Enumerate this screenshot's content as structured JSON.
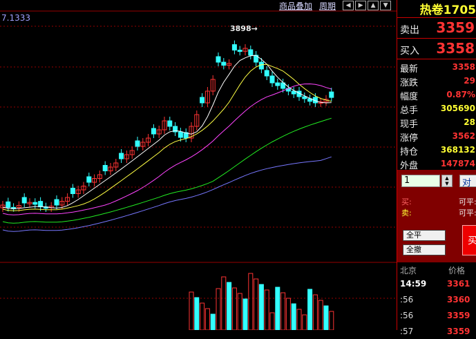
{
  "toolbar": {
    "overlay": "商品叠加",
    "period": "周期",
    "nav_icons": [
      "arrow-left-icon",
      "arrow-right-icon",
      "zoom-in-icon",
      "zoom-out-icon"
    ]
  },
  "chart": {
    "ma_value": "7.1333",
    "peak_label": "3898",
    "colors": {
      "up": "#ff3333",
      "down": "#33ffff",
      "grid": "#990000",
      "ma5": "#ffffff",
      "ma10": "#ffff44",
      "ma20": "#ff44ff",
      "ma40": "#22ee22",
      "ma60": "#7777ff"
    }
  },
  "quote": {
    "contract": "热卷1705",
    "sell": {
      "label": "卖出",
      "value": "3359"
    },
    "buy": {
      "label": "买入",
      "value": "3358"
    },
    "stats": [
      {
        "label": "最新",
        "value": "3358",
        "color": "#ff3333"
      },
      {
        "label": "涨跌",
        "value": "29",
        "color": "#ff3333"
      },
      {
        "label": "幅度",
        "value": "0.87%",
        "color": "#ff3333"
      },
      {
        "label": "总手",
        "value": "305690",
        "color": "#ffff33"
      },
      {
        "label": "现手",
        "value": "28",
        "color": "#ffff33"
      },
      {
        "label": "涨停",
        "value": "3562",
        "color": "#ff3333"
      },
      {
        "label": "持仓",
        "value": "368132",
        "color": "#ffff33"
      },
      {
        "label": "外盘",
        "value": "147874",
        "color": "#ff3333"
      }
    ]
  },
  "order": {
    "qty": "1",
    "side_button": "对手",
    "buy_label": "买:",
    "sell_label": "卖:",
    "avail_buy": "可平:",
    "avail_sell": "可平:",
    "close_all": "全平",
    "cancel_all": "全撤",
    "submit": "买"
  },
  "ticks": {
    "header_loc": "北京",
    "header_price": "价格",
    "rows": [
      {
        "time": "14:59",
        "price": "3361"
      },
      {
        "time": ":56",
        "price": "3360"
      },
      {
        "time": ":56",
        "price": "3359"
      },
      {
        "time": ":57",
        "price": "3359"
      }
    ]
  }
}
